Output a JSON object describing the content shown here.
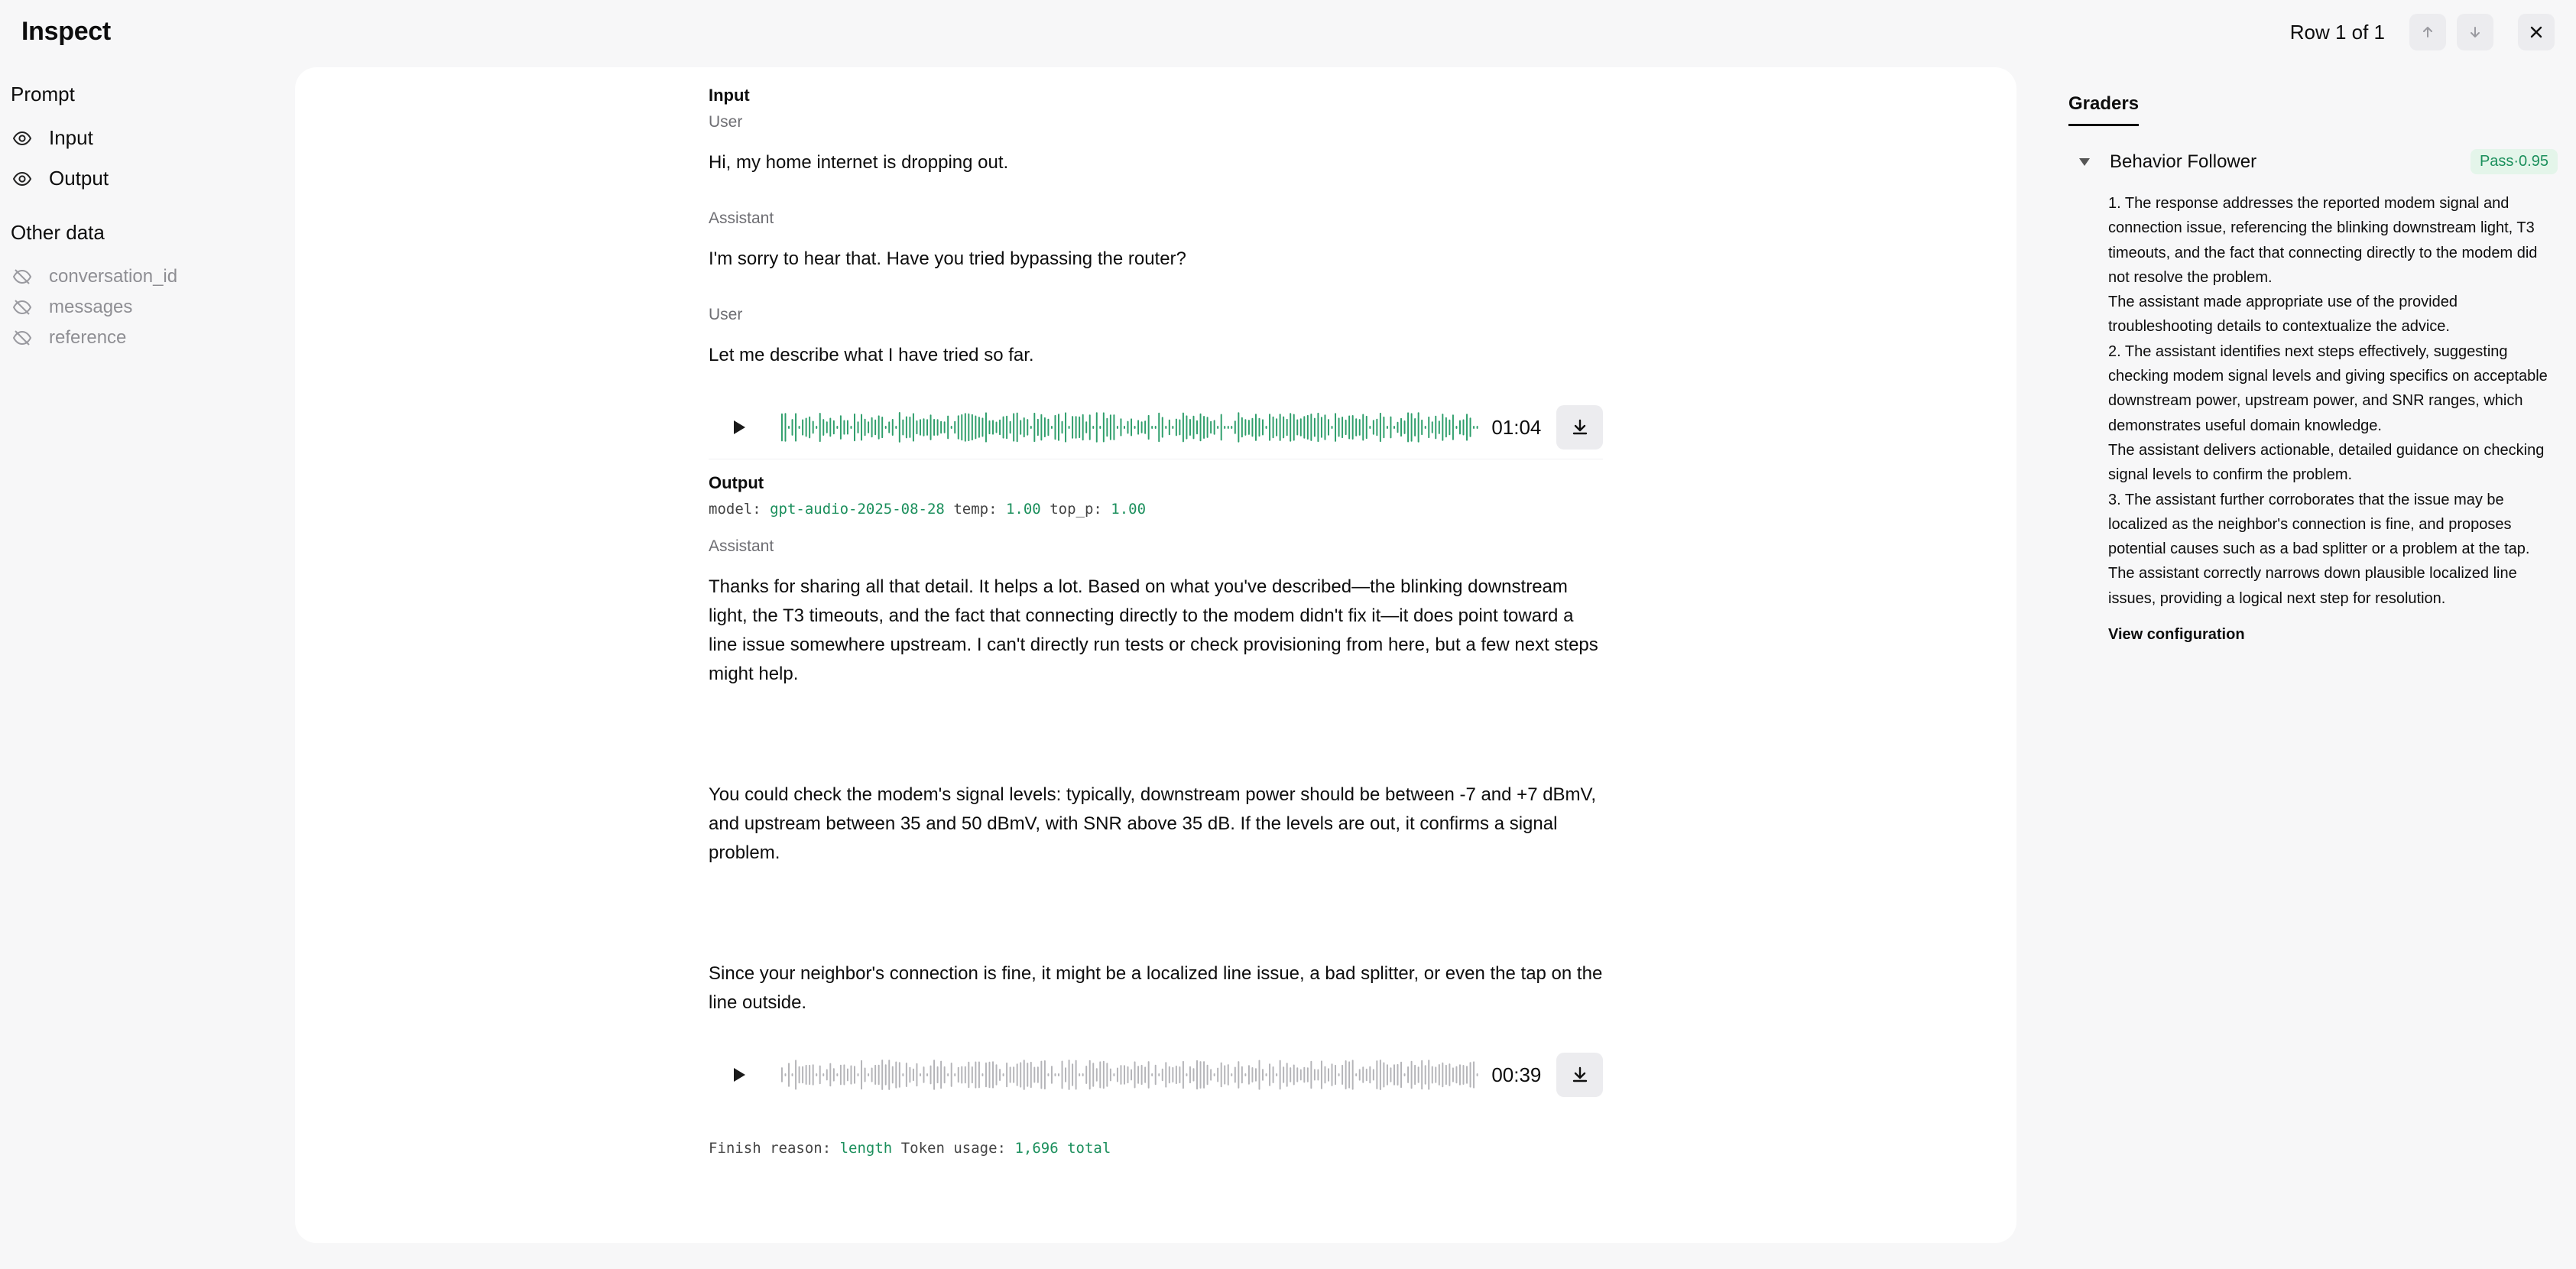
{
  "header": {
    "title": "Inspect",
    "row_indicator": "Row 1 of 1"
  },
  "sidebar": {
    "prompt_heading": "Prompt",
    "prompt_items": [
      {
        "label": "Input",
        "icon": "eye-icon"
      },
      {
        "label": "Output",
        "icon": "eye-icon"
      }
    ],
    "other_heading": "Other data",
    "other_items": [
      {
        "label": "conversation_id",
        "icon": "eye-off-icon"
      },
      {
        "label": "messages",
        "icon": "eye-off-icon"
      },
      {
        "label": "reference",
        "icon": "eye-off-icon"
      }
    ]
  },
  "input": {
    "title": "Input",
    "messages": [
      {
        "role": "User",
        "text": "Hi, my home internet is dropping out."
      },
      {
        "role": "Assistant",
        "text": "I'm sorry to hear that. Have you tried bypassing the router?"
      },
      {
        "role": "User",
        "text": "Let me describe what I have tried so far."
      }
    ],
    "audio": {
      "duration": "01:04",
      "color": "#2e9e6b"
    }
  },
  "output": {
    "title": "Output",
    "meta": {
      "model_label": "model:",
      "model": "gpt-audio-2025-08-28",
      "temp_label": "temp:",
      "temp": "1.00",
      "top_p_label": "top_p:",
      "top_p": "1.00"
    },
    "role": "Assistant",
    "paragraphs": [
      "Thanks for sharing all that detail. It helps a lot. Based on what you've described—the blinking downstream light, the T3 timeouts, and the fact that connecting directly to the modem didn't fix it—it does point toward a line issue somewhere upstream. I can't directly run tests or check provisioning from here, but a few next steps might help.",
      "You could check the modem's signal levels: typically, downstream power should be between -7 and +7 dBmV, and upstream between 35 and 50 dBmV, with SNR above 35 dB. If the levels are out, it confirms a signal problem.",
      "Since your neighbor's connection is fine, it might be a localized line issue, a bad splitter, or even the tap on the line outside."
    ],
    "audio": {
      "duration": "00:39",
      "color": "#b4b4b8"
    },
    "finish": {
      "reason_label": "Finish reason:",
      "reason": "length",
      "token_label": "Token usage:",
      "tokens": "1,696 total"
    }
  },
  "graders": {
    "tab": "Graders",
    "name": "Behavior Follower",
    "badge": "Pass·0.95",
    "reasons": [
      "1. The response addresses the reported modem signal and connection issue, referencing the blinking downstream light, T3 timeouts, and the fact that connecting directly to the modem did not resolve the problem.",
      "The assistant made appropriate use of the provided troubleshooting details to contextualize the advice.",
      "2. The assistant identifies next steps effectively, suggesting checking modem signal levels and giving specifics on acceptable downstream power, upstream power, and SNR ranges, which demonstrates useful domain knowledge.",
      "The assistant delivers actionable, detailed guidance on checking signal levels to confirm the problem.",
      "3. The assistant further corroborates that the issue may be localized as the neighbor's connection is fine, and proposes potential causes such as a bad splitter or a problem at the tap.",
      "The assistant correctly narrows down plausible localized line issues, providing a logical next step for resolution."
    ],
    "view_config": "View configuration"
  }
}
